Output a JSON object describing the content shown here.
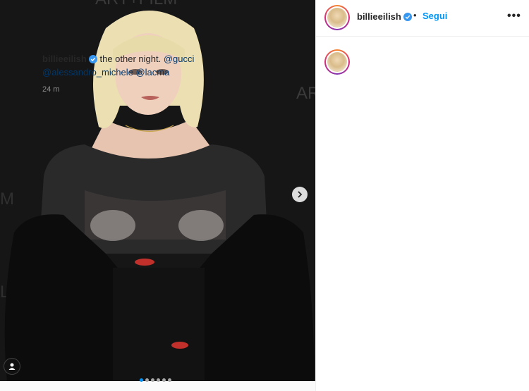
{
  "post": {
    "username": "billieeilish",
    "follow_label": "Segui",
    "separator": "•",
    "more_label": "•••",
    "caption_text": "the other night.",
    "mentions": [
      "@gucci",
      "@alessandro_michele",
      "@lacma"
    ],
    "time_ago": "24 m",
    "carousel": {
      "count": 6,
      "active_index": 0
    }
  },
  "colors": {
    "accent": "#0095f6",
    "verified": "#3897f0",
    "mention": "#00376b",
    "muted": "#8e8e8e"
  },
  "icons": [
    "chevron-right-icon",
    "user-tag-icon",
    "verified-badge-icon",
    "more-options-icon"
  ]
}
